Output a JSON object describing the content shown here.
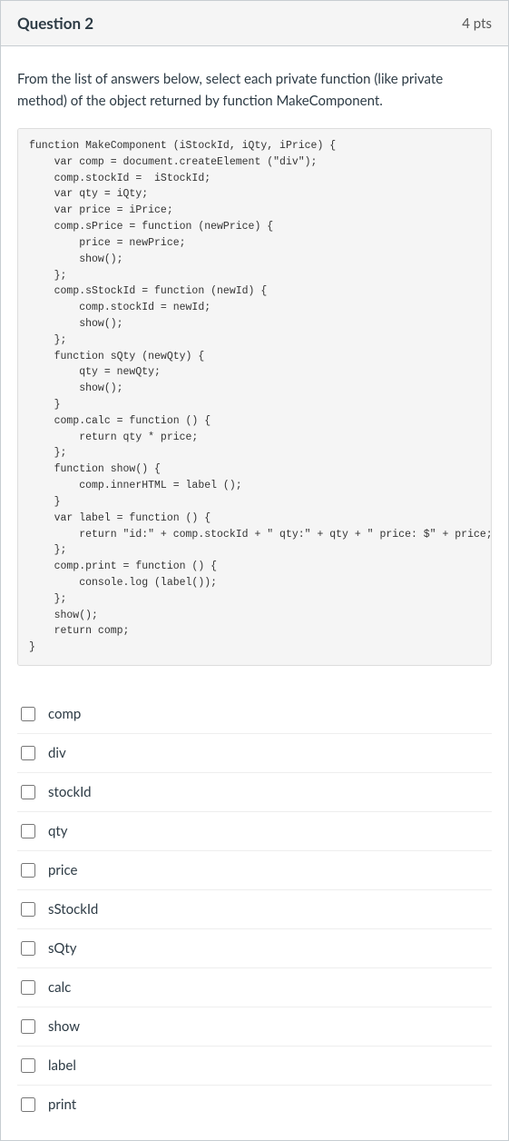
{
  "header": {
    "title": "Question 2",
    "points": "4 pts"
  },
  "prompt": "From the list of answers below, select each private function (like private method) of the object returned by function MakeComponent.",
  "code": "function MakeComponent (iStockId, iQty, iPrice) {\n    var comp = document.createElement (\"div\");\n    comp.stockId =  iStockId;\n    var qty = iQty;\n    var price = iPrice;\n    comp.sPrice = function (newPrice) {\n        price = newPrice;\n        show();\n    };\n    comp.sStockId = function (newId) {\n        comp.stockId = newId;\n        show();\n    };\n    function sQty (newQty) {\n        qty = newQty;\n        show();\n    }\n    comp.calc = function () {\n        return qty * price;\n    };\n    function show() {\n        comp.innerHTML = label ();\n    }\n    var label = function () {\n        return \"id:\" + comp.stockId + \" qty:\" + qty + \" price: $\" + price;\n    };\n    comp.print = function () {\n        console.log (label());\n    };\n    show();\n    return comp;\n}",
  "answers": [
    {
      "label": "comp"
    },
    {
      "label": "div"
    },
    {
      "label": "stockId"
    },
    {
      "label": "qty"
    },
    {
      "label": "price"
    },
    {
      "label": "sStockId"
    },
    {
      "label": "sQty"
    },
    {
      "label": "calc"
    },
    {
      "label": "show"
    },
    {
      "label": "label"
    },
    {
      "label": "print"
    }
  ]
}
